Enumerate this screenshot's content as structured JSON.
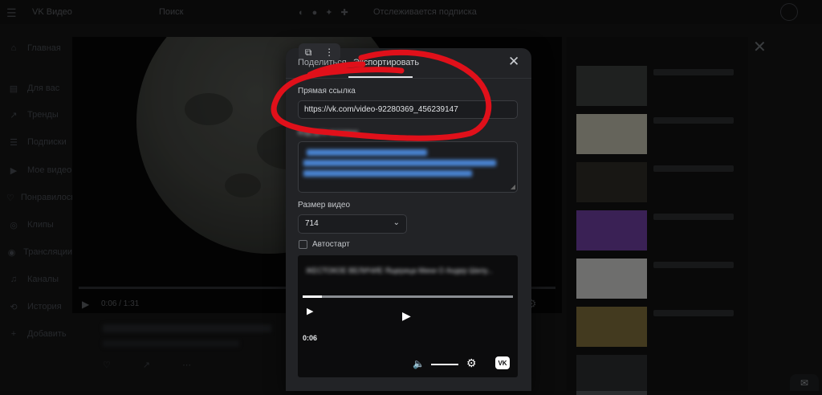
{
  "topbar": {
    "logo": "VK Видео",
    "search": "Поиск",
    "status": "Отслеживается подписка"
  },
  "sidenav": {
    "items": [
      {
        "icon": "home-icon",
        "glyph": "⌂",
        "label": "Главная"
      },
      {
        "icon": "feed-icon",
        "glyph": "▤",
        "label": "Для вас"
      },
      {
        "icon": "trending-icon",
        "glyph": "↗",
        "label": "Тренды"
      },
      {
        "icon": "subs-icon",
        "glyph": "☰",
        "label": "Подписки"
      },
      {
        "icon": "my-video-icon",
        "glyph": "▶",
        "label": "Мое видео"
      },
      {
        "icon": "liked-icon",
        "glyph": "♡",
        "label": "Понравилось"
      },
      {
        "icon": "clips-icon",
        "glyph": "◎",
        "label": "Клипы"
      },
      {
        "icon": "live-icon",
        "glyph": "◉",
        "label": "Трансляции"
      },
      {
        "icon": "channels-icon",
        "glyph": "♫",
        "label": "Каналы"
      },
      {
        "icon": "history-icon",
        "glyph": "⟲",
        "label": "История"
      },
      {
        "icon": "add-icon",
        "glyph": "+",
        "label": "Добавить"
      }
    ]
  },
  "background_player": {
    "time": "0:06 / 1:31"
  },
  "modal": {
    "tab_share": "Поделиться",
    "tab_export": "Экспортировать",
    "direct_link_label": "Прямая ссылка",
    "direct_link_value": "https://vk.com/video-92280369_456239147",
    "embed_label": "Код для вставки",
    "size_label": "Размер видео",
    "size_value": "714",
    "autostart_label": "Автостарт",
    "preview": {
      "title": "ЖЕСТОКОЕ ВЕЛИЧИЕ Ящерица Мини О Андер Шилу...",
      "time": "0:06"
    }
  },
  "annotation": {
    "color": "#e0101a"
  }
}
